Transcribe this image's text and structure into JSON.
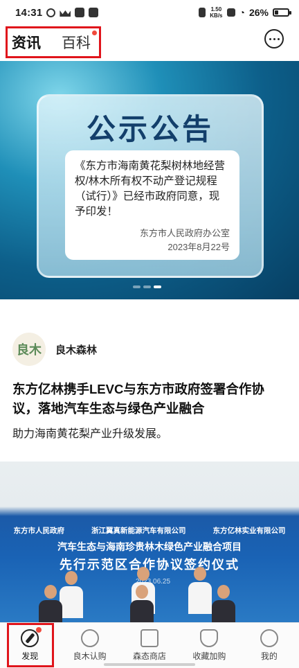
{
  "status_bar": {
    "time": "14:31",
    "net_speed_value": "1.50",
    "net_speed_unit": "KB/s",
    "battery": "26%",
    "battery_level": 0.26
  },
  "header": {
    "tabs": [
      {
        "label": "资讯",
        "active": true
      },
      {
        "label": "百科",
        "active": false,
        "has_dot": true
      }
    ],
    "message_icon": "chat-bubble-icon"
  },
  "banner": {
    "title": "公示公告",
    "text": "《东方市海南黄花梨树林地经营权/林木所有权不动产登记规程（试行）》已经市政府同意，现予印发！",
    "signature": "东方市人民政府办公室",
    "date": "2023年8月22号",
    "carousel": {
      "count": 3,
      "active_index": 2
    }
  },
  "article": {
    "author_avatar_text": "良木",
    "author_name": "良木森林",
    "title": "东方亿林携手LEVC与东方市政府签署合作协议，落地汽车生态与绿色产业融合",
    "subtitle": "助力海南黄花梨产业升级发展。",
    "photo": {
      "orgs": [
        "东方市人民政府",
        "浙江翼真新能源汽车有限公司",
        "东方亿林实业有限公司"
      ],
      "line1": "汽车生态与海南珍贵林木绿色产业融合项目",
      "line2": "先行示范区合作协议签约仪式",
      "date": "2023.06.25"
    }
  },
  "bottom_nav": [
    {
      "label": "发现",
      "icon": "compass-icon",
      "active": true,
      "has_dot": true
    },
    {
      "label": "良木认购",
      "icon": "tree-badge-icon",
      "active": false
    },
    {
      "label": "森态商店",
      "icon": "shopping-bag-icon",
      "active": false
    },
    {
      "label": "收藏加购",
      "icon": "collection-icon",
      "active": false
    },
    {
      "label": "我的",
      "icon": "profile-icon",
      "active": false
    }
  ]
}
